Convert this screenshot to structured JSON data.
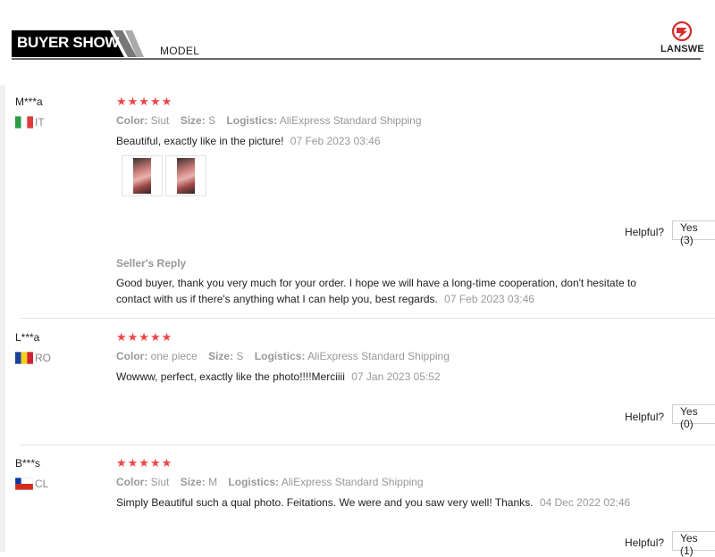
{
  "header": {
    "title": "BUYER SHOW",
    "tab": "MODEL",
    "brand": "LANSWE",
    "accent": "#000000"
  },
  "reviews": [
    {
      "user": "M***a",
      "country": "IT",
      "flag_colors": [
        "#2b9c47",
        "#ffffff",
        "#e03a3e"
      ],
      "stars": "★★★★★",
      "color_label": "Color:",
      "color": "Siut",
      "size_label": "Size:",
      "size": "S",
      "logistics_label": "Logistics:",
      "logistics": "AliExpress Standard Shipping",
      "text": "Beautiful, exactly like in the picture!",
      "date": "07 Feb 2023 03:46",
      "photos": [
        "review-photo",
        "review-photo"
      ],
      "helpful_label": "Helpful?",
      "yes_label": "Yes (3)",
      "seller_reply_title": "Seller's Reply",
      "seller_reply": "Good buyer, thank you very much for your order. I hope we will have a long-time cooperation, don't hesitate to contact with us if there's anything what I can help you, best regards.",
      "seller_reply_date": "07 Feb 2023 03:46"
    },
    {
      "user": "L***a",
      "country": "RO",
      "flag_colors": [
        "#1d3f9a",
        "#f6cf1d",
        "#d2222e"
      ],
      "stars": "★★★★★",
      "color_label": "Color:",
      "color": "one piece",
      "size_label": "Size:",
      "size": "S",
      "logistics_label": "Logistics:",
      "logistics": "AliExpress Standard Shipping",
      "text": "Wowww, perfect, exactly like the photo!!!!Merciiii",
      "date": "07 Jan 2023 05:52",
      "helpful_label": "Helpful?",
      "yes_label": "Yes (0)"
    },
    {
      "user": "B***s",
      "country": "CL",
      "flag_colors": [
        "#ffffff",
        "#d52b1e",
        "#0039a6"
      ],
      "stars": "★★★★★",
      "color_label": "Color:",
      "color": "Siut",
      "size_label": "Size:",
      "size": "M",
      "logistics_label": "Logistics:",
      "logistics": "AliExpress Standard Shipping",
      "text": "Simply Beautiful such a qual photo. Feitations. We were and you saw very well! Thanks.",
      "date": "04 Dec 2022 02:46",
      "helpful_label": "Helpful?",
      "yes_label": "Yes (1)"
    }
  ]
}
